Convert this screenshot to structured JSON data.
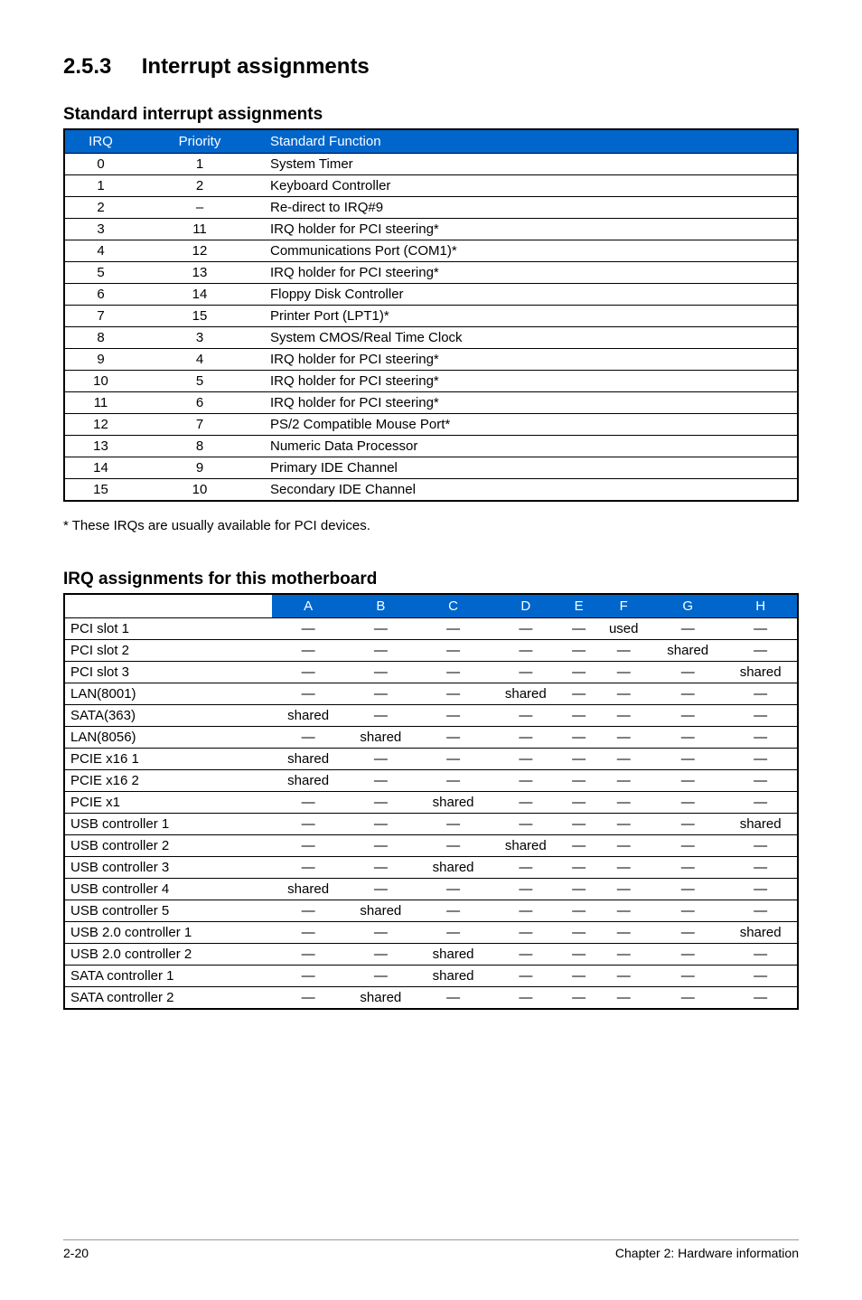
{
  "section": {
    "number": "2.5.3",
    "title": "Interrupt assignments"
  },
  "standardTable": {
    "title": "Standard interrupt assignments",
    "headers": [
      "IRQ",
      "Priority",
      "Standard Function"
    ],
    "rows": [
      {
        "irq": "0",
        "priority": "1",
        "func": "System Timer"
      },
      {
        "irq": "1",
        "priority": "2",
        "func": "Keyboard Controller"
      },
      {
        "irq": "2",
        "priority": "–",
        "func": "Re-direct to IRQ#9"
      },
      {
        "irq": "3",
        "priority": "11",
        "func": "IRQ holder for PCI steering*"
      },
      {
        "irq": "4",
        "priority": "12",
        "func": "Communications Port (COM1)*"
      },
      {
        "irq": "5",
        "priority": "13",
        "func": "IRQ holder for PCI steering*"
      },
      {
        "irq": "6",
        "priority": "14",
        "func": "Floppy Disk Controller"
      },
      {
        "irq": "7",
        "priority": "15",
        "func": "Printer Port (LPT1)*"
      },
      {
        "irq": "8",
        "priority": "3",
        "func": "System CMOS/Real Time Clock"
      },
      {
        "irq": "9",
        "priority": "4",
        "func": "IRQ holder for PCI steering*"
      },
      {
        "irq": "10",
        "priority": "5",
        "func": "IRQ holder for PCI steering*"
      },
      {
        "irq": "11",
        "priority": "6",
        "func": "IRQ holder for PCI steering*"
      },
      {
        "irq": "12",
        "priority": "7",
        "func": "PS/2 Compatible Mouse Port*"
      },
      {
        "irq": "13",
        "priority": "8",
        "func": "Numeric Data Processor"
      },
      {
        "irq": "14",
        "priority": "9",
        "func": "Primary IDE Channel"
      },
      {
        "irq": "15",
        "priority": "10",
        "func": "Secondary IDE Channel"
      }
    ],
    "footnote": "* These IRQs are usually available for PCI devices."
  },
  "irqTable": {
    "title": "IRQ assignments for this motherboard",
    "headers": [
      "",
      "A",
      "B",
      "C",
      "D",
      "E",
      "F",
      "G",
      "H"
    ],
    "rows": [
      {
        "label": "PCI slot 1",
        "cells": [
          "—",
          "—",
          "—",
          "—",
          "—",
          "used",
          "—",
          "—"
        ]
      },
      {
        "label": "PCI slot 2",
        "cells": [
          "—",
          "—",
          "—",
          "—",
          "—",
          "—",
          "shared",
          "—"
        ]
      },
      {
        "label": "PCI slot 3",
        "cells": [
          "—",
          "—",
          "—",
          "—",
          "—",
          "—",
          "—",
          "shared"
        ]
      },
      {
        "label": "LAN(8001)",
        "cells": [
          "—",
          "—",
          "—",
          "shared",
          "—",
          "—",
          "—",
          "—"
        ]
      },
      {
        "label": "SATA(363)",
        "cells": [
          "shared",
          "—",
          "—",
          "—",
          "—",
          "—",
          "—",
          "—"
        ]
      },
      {
        "label": "LAN(8056)",
        "cells": [
          "—",
          "shared",
          "—",
          "—",
          "—",
          "—",
          "—",
          "—"
        ]
      },
      {
        "label": "PCIE x16 1",
        "cells": [
          "shared",
          "—",
          "—",
          "—",
          "—",
          "—",
          "—",
          "—"
        ]
      },
      {
        "label": "PCIE x16 2",
        "cells": [
          "shared",
          "—",
          "—",
          "—",
          "—",
          "—",
          "—",
          "—"
        ]
      },
      {
        "label": "PCIE x1",
        "cells": [
          "—",
          "—",
          "shared",
          "—",
          "—",
          "—",
          "—",
          "—"
        ]
      },
      {
        "label": "USB controller 1",
        "cells": [
          "—",
          "—",
          "—",
          "—",
          "—",
          "—",
          "—",
          "shared"
        ]
      },
      {
        "label": "USB controller 2",
        "cells": [
          "—",
          "—",
          "—",
          "shared",
          "—",
          "—",
          "—",
          "—"
        ]
      },
      {
        "label": "USB controller 3",
        "cells": [
          "—",
          "—",
          "shared",
          "—",
          "—",
          "—",
          "—",
          "—"
        ]
      },
      {
        "label": "USB controller 4",
        "cells": [
          "shared",
          "—",
          "—",
          "—",
          "—",
          "—",
          "—",
          "—"
        ]
      },
      {
        "label": "USB controller 5",
        "cells": [
          "—",
          "shared",
          "—",
          "—",
          "—",
          "—",
          "—",
          "—"
        ]
      },
      {
        "label": "USB 2.0 controller 1",
        "cells": [
          "—",
          "—",
          "—",
          "—",
          "—",
          "—",
          "—",
          "shared"
        ]
      },
      {
        "label": "USB 2.0 controller 2",
        "cells": [
          "—",
          "—",
          "shared",
          "—",
          "—",
          "—",
          "—",
          "—"
        ]
      },
      {
        "label": "SATA controller 1",
        "cells": [
          "—",
          "—",
          "shared",
          "—",
          "—",
          "—",
          "—",
          "—"
        ]
      },
      {
        "label": "SATA controller 2",
        "cells": [
          "—",
          "shared",
          "—",
          "—",
          "—",
          "—",
          "—",
          "—"
        ]
      }
    ]
  },
  "footer": {
    "left": "2-20",
    "right": "Chapter 2: Hardware information"
  }
}
